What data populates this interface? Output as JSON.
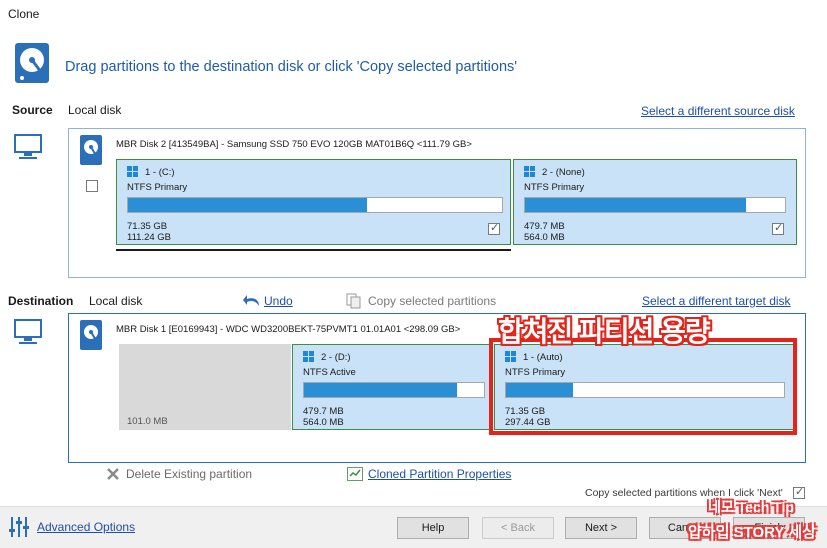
{
  "window": {
    "title": "Clone"
  },
  "header": {
    "instruction": "Drag partitions to the destination disk or click 'Copy selected partitions'"
  },
  "source": {
    "label": "Source",
    "disk_label": "Local disk",
    "change_link": "Select a different source disk",
    "disk_title": "MBR Disk 2 [413549BA] - Samsung SSD 750 EVO 120GB MAT01B6Q  <111.79 GB>",
    "partitions": [
      {
        "name": "1 -  (C:)",
        "type": "NTFS Primary",
        "used": "71.35 GB",
        "size": "111.24 GB",
        "fill": 0.64,
        "checked": true
      },
      {
        "name": "2 -  (None)",
        "type": "NTFS Primary",
        "used": "479.7 MB",
        "size": "564.0 MB",
        "fill": 0.85,
        "checked": true
      }
    ]
  },
  "destination": {
    "label": "Destination",
    "disk_label": "Local disk",
    "undo": "Undo",
    "copy_selected": "Copy selected partitions",
    "change_link": "Select a different target disk",
    "disk_title": "MBR Disk 1 [E0169943] - WDC WD3200BEKT-75PVMT1 01.01A01  <298.09 GB>",
    "unallocated": "101.0 MB",
    "partitions": [
      {
        "name": "2 -  (D:)",
        "type": "NTFS Active",
        "used": "479.7 MB",
        "size": "564.0 MB",
        "fill": 0.85
      },
      {
        "name": "1 -  (Auto)",
        "type": "NTFS Primary",
        "used": "71.35 GB",
        "size": "297.44 GB",
        "fill": 0.24
      }
    ]
  },
  "annotation": {
    "text": "합쳐진 파티션 용량",
    "color": "#e3241b"
  },
  "actions": {
    "delete_existing": "Delete Existing partition",
    "cloned_properties": "Cloned Partition Properties",
    "copy_on_next": "Copy selected partitions when I click 'Next'"
  },
  "footer": {
    "advanced": "Advanced Options",
    "help": "Help",
    "back": "< Back",
    "next": "Next >",
    "cancel": "Cancel",
    "finish": "Finish"
  },
  "watermark": {
    "line1": "네모 Tech Tip",
    "line2": "얍하입 STORY 세상"
  }
}
